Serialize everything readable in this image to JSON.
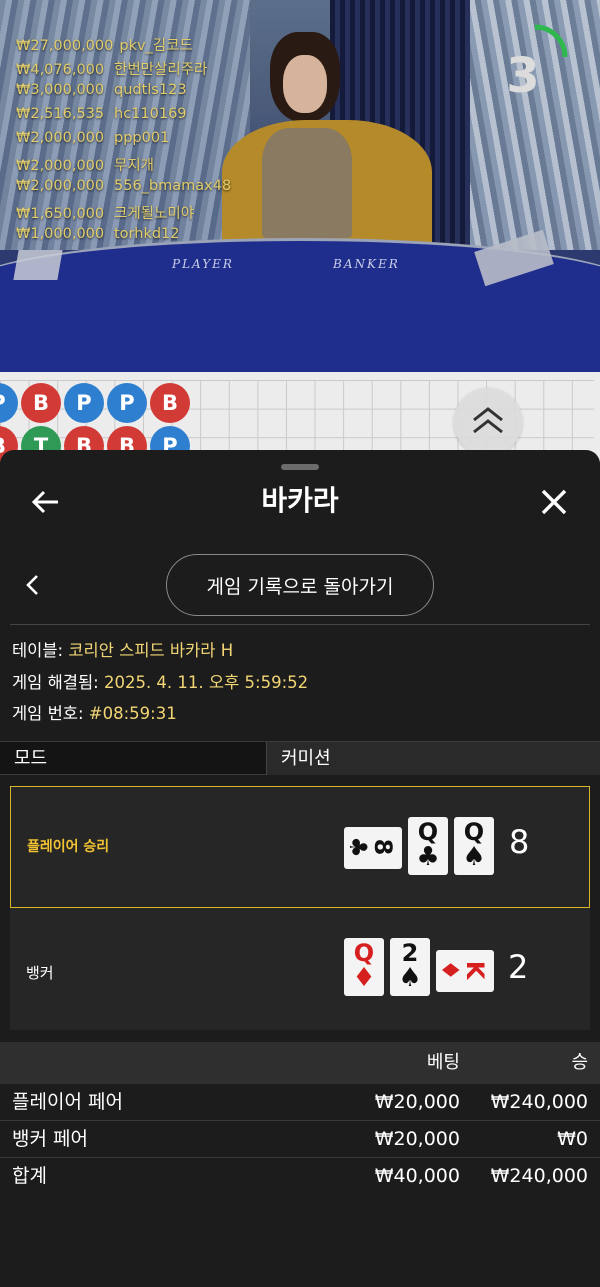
{
  "video": {
    "felt_player": "PLAYER",
    "felt_banker": "BANKER",
    "countdown": "3",
    "countdown_progress": 0.25,
    "winners": [
      {
        "amount": "₩27,000,000",
        "name": "pkv_김코드"
      },
      {
        "amount": "₩4,076,000",
        "name": "한번만살리주라"
      },
      {
        "amount": "₩3,000,000",
        "name": "qudtls123"
      },
      {
        "amount": "₩2,516,535",
        "name": "hc110169"
      },
      {
        "amount": "₩2,000,000",
        "name": "ppp001"
      },
      {
        "amount": "₩2,000,000",
        "name": "무지개"
      },
      {
        "amount": "₩2,000,000",
        "name": "556_bmamax48"
      },
      {
        "amount": "₩1,650,000",
        "name": "크게될노미야"
      },
      {
        "amount": "₩1,000,000",
        "name": "torhkd12"
      }
    ]
  },
  "road": {
    "beads": [
      {
        "letter": "P",
        "color": "p",
        "col": 0,
        "row": 0
      },
      {
        "letter": "B",
        "color": "b",
        "col": 1,
        "row": 0
      },
      {
        "letter": "P",
        "color": "p",
        "col": 2,
        "row": 0
      },
      {
        "letter": "P",
        "color": "p",
        "col": 3,
        "row": 0
      },
      {
        "letter": "B",
        "color": "b",
        "col": 4,
        "row": 0
      },
      {
        "letter": "B",
        "color": "b",
        "col": 0,
        "row": 1
      },
      {
        "letter": "T",
        "color": "t",
        "col": 1,
        "row": 1
      },
      {
        "letter": "B",
        "color": "b",
        "col": 2,
        "row": 1
      },
      {
        "letter": "B",
        "color": "b",
        "col": 3,
        "row": 1
      },
      {
        "letter": "P",
        "color": "p",
        "col": 4,
        "row": 1
      }
    ],
    "up_icon": "double-chevron-up-icon"
  },
  "panel": {
    "title": "바카라",
    "back_icon": "arrow-left-icon",
    "close_icon": "close-icon",
    "prev_icon": "chevron-left-icon",
    "history_button": "게임 기록으로 돌아가기",
    "info": {
      "table_label": "테이블: ",
      "table_value": "코리안 스피드 바카라 H",
      "resolved_label": "게임 해결됨: ",
      "resolved_value": "2025. 4. 11. 오후 5:59:52",
      "number_label": "게임 번호: ",
      "number_value": "#08:59:31"
    },
    "mode_label": "모드",
    "mode_value": "커미션",
    "hands": {
      "player": {
        "label": "플레이어 승리",
        "score": "8",
        "cards": [
          {
            "rank": "8",
            "suit": "♣",
            "red": false,
            "sideways": true
          },
          {
            "rank": "Q",
            "suit": "♣",
            "red": false,
            "sideways": false
          },
          {
            "rank": "Q",
            "suit": "♠",
            "red": false,
            "sideways": false
          }
        ]
      },
      "banker": {
        "label": "뱅커",
        "score": "2",
        "cards": [
          {
            "rank": "Q",
            "suit": "♦",
            "red": true,
            "sideways": false
          },
          {
            "rank": "2",
            "suit": "♠",
            "red": false,
            "sideways": false
          },
          {
            "rank": "K",
            "suit": "♦",
            "red": true,
            "sideways": true
          }
        ]
      }
    },
    "bets": {
      "head_bet": "베팅",
      "head_win": "승",
      "rows": [
        {
          "name": "플레이어 페어",
          "bet": "₩20,000",
          "win": "₩240,000"
        },
        {
          "name": "뱅커 페어",
          "bet": "₩20,000",
          "win": "₩0"
        },
        {
          "name": "합계",
          "bet": "₩40,000",
          "win": "₩240,000"
        }
      ]
    },
    "accent": "#d8b62c",
    "info_value_color": "#f2d675"
  }
}
